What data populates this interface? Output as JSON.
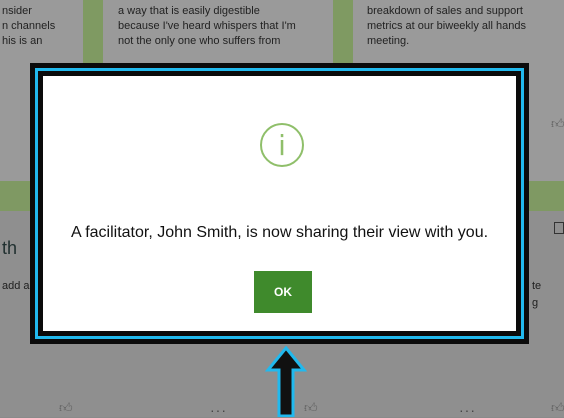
{
  "cards_top": [
    {
      "lines": [
        "nsider",
        "n channels",
        "his is an"
      ]
    },
    {
      "lines": [
        "a way that is easily digestible",
        "because I've heard whispers that I'm",
        "not the only one who suffers from"
      ]
    },
    {
      "lines": [
        "breakdown of sales and support",
        "metrics at our biweekly all hands",
        "meeting."
      ]
    }
  ],
  "lower_fragments": {
    "left_big": "th",
    "left_small": "add a",
    "right_small_1": "te",
    "right_small_2": "g"
  },
  "dialog": {
    "icon": "info-icon",
    "message": "A facilitator, John Smith, is now sharing their view with you.",
    "ok_label": "OK"
  },
  "colors": {
    "accent_green": "#3f8a2c",
    "icon_green": "#8fbf6a",
    "highlight_blue": "#21b9ee",
    "card_strip_green": "#7f9a62"
  }
}
